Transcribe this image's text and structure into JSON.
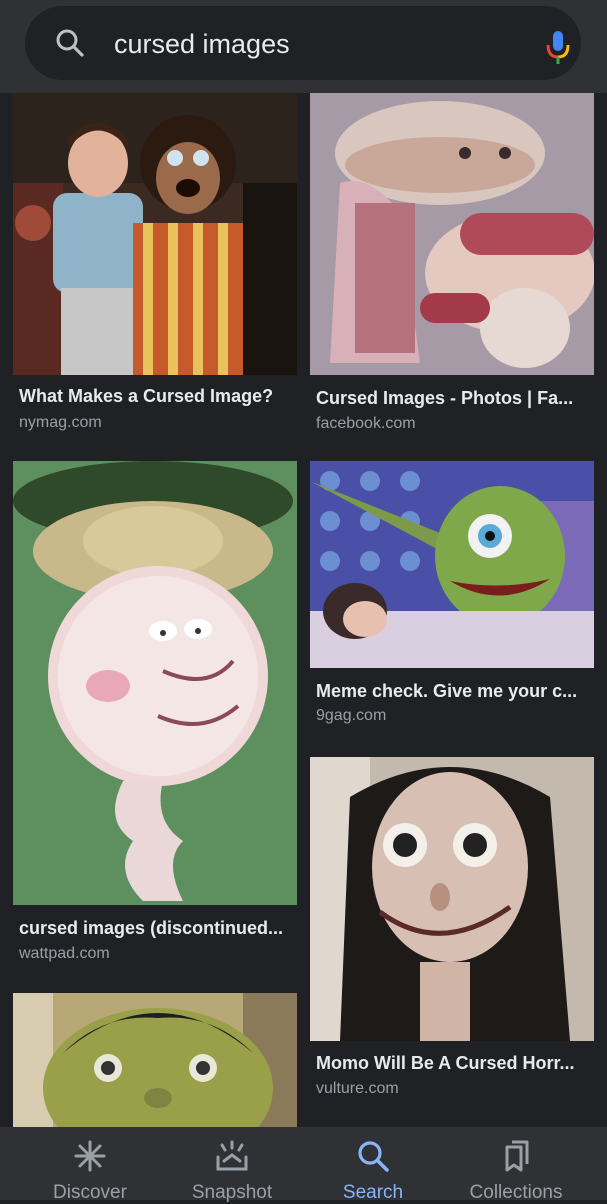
{
  "search": {
    "query": "cursed images"
  },
  "results": [
    {
      "title": "What Makes a Cursed Image?",
      "source": "nymag.com",
      "image": "person posing with a mascot costume"
    },
    {
      "title": "Cursed Images - Photos | Fa...",
      "source": "facebook.com",
      "image": "sandwich with a face eating a hot dog"
    },
    {
      "title": "cursed images (discontinued...",
      "source": "wattpad.com",
      "image": "blurry cartoon character wearing a straw hat"
    },
    {
      "title": "Meme check. Give me your c...",
      "source": "9gag.com",
      "image": "green one-eyed monster beside a sleeping child"
    },
    {
      "title": "Momo Will Be A Cursed Horr...",
      "source": "vulture.com",
      "image": "sculpture with bulging eyes and long dark hair"
    },
    {
      "title": "",
      "source": "",
      "image": "green-skinned figure with dark hair"
    }
  ],
  "nav": {
    "items": [
      {
        "label": "Discover",
        "icon": "asterisk-icon"
      },
      {
        "label": "Snapshot",
        "icon": "snapshot-icon"
      },
      {
        "label": "Search",
        "icon": "search-icon",
        "active": true
      },
      {
        "label": "Collections",
        "icon": "collections-icon"
      }
    ],
    "active_color": "#8ab4f8",
    "inactive_color": "#9aa0a6"
  },
  "colors": {
    "background": "#202124",
    "surface": "#303134",
    "text": "#e8eaed",
    "secondary_text": "#9aa0a6"
  }
}
